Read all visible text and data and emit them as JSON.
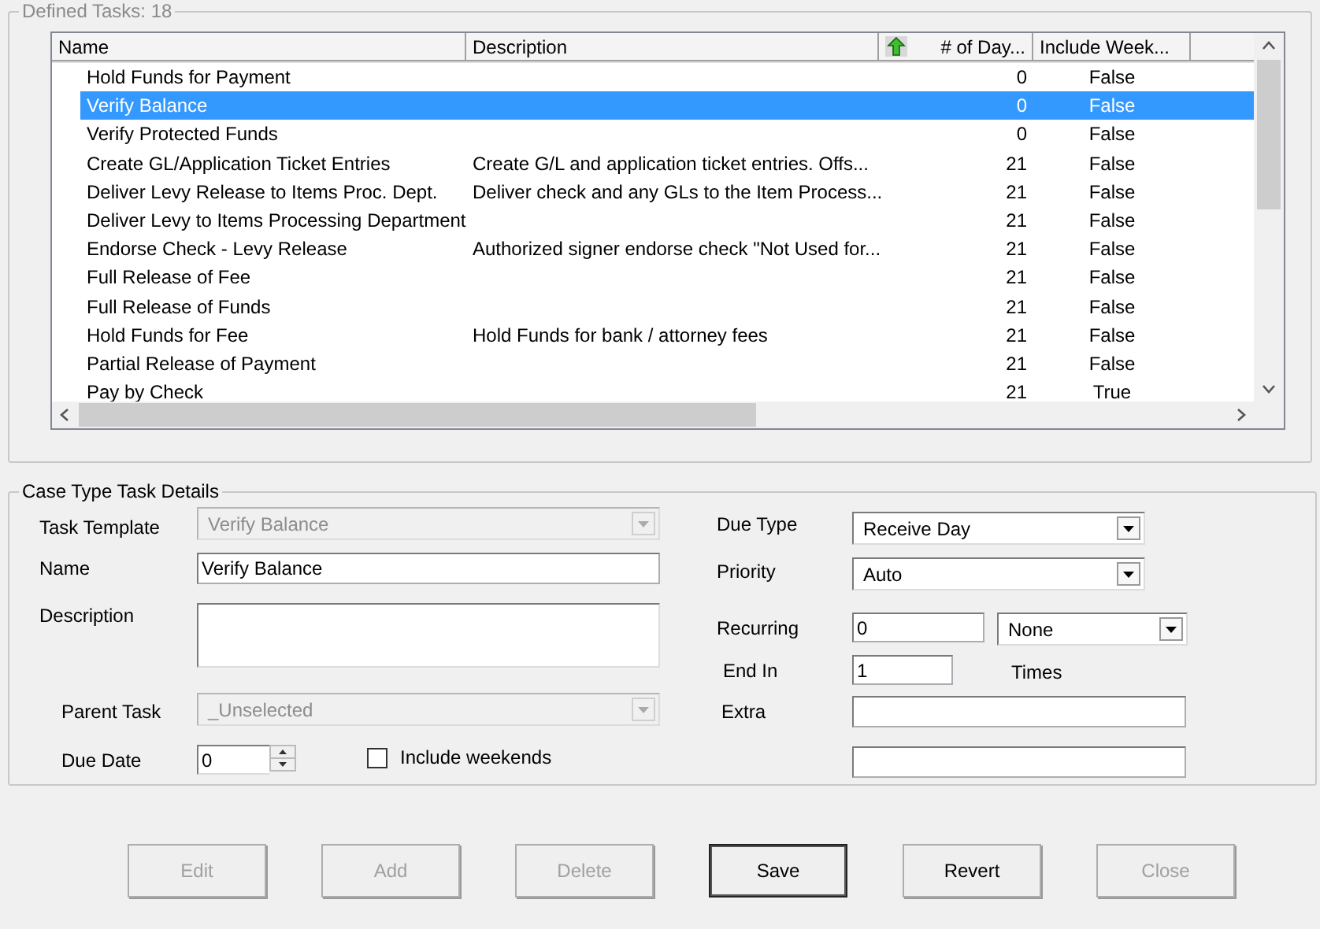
{
  "tasks_group": {
    "title": "Defined Tasks: 18",
    "columns": [
      {
        "label": "Name",
        "sorted": false
      },
      {
        "label": "Description",
        "sorted": false
      },
      {
        "label": "# of Day...",
        "sorted": true
      },
      {
        "label": "Include Week...",
        "sorted": false
      }
    ],
    "rows": [
      {
        "name": "Hold Funds for Payment",
        "description": "",
        "days": "0",
        "include_weekends": "False",
        "selected": false
      },
      {
        "name": "Verify Balance",
        "description": "",
        "days": "0",
        "include_weekends": "False",
        "selected": true
      },
      {
        "name": "Verify Protected Funds",
        "description": "",
        "days": "0",
        "include_weekends": "False",
        "selected": false
      },
      {
        "name": "Create GL/Application Ticket Entries",
        "description": "Create G/L and application ticket entries.  Offs...",
        "days": "21",
        "include_weekends": "False",
        "selected": false
      },
      {
        "name": "Deliver Levy Release to Items Proc. Dept.",
        "description": "Deliver check and any GLs to the Item Process...",
        "days": "21",
        "include_weekends": "False",
        "selected": false
      },
      {
        "name": "Deliver Levy to Items Processing Department",
        "description": "",
        "days": "21",
        "include_weekends": "False",
        "selected": false
      },
      {
        "name": "Endorse Check - Levy Release",
        "description": "Authorized signer endorse check \"Not Used for...",
        "days": "21",
        "include_weekends": "False",
        "selected": false
      },
      {
        "name": "Full Release of Fee",
        "description": "",
        "days": "21",
        "include_weekends": "False",
        "selected": false
      },
      {
        "name": "Full Release of Funds",
        "description": "",
        "days": "21",
        "include_weekends": "False",
        "selected": false
      },
      {
        "name": "Hold Funds for Fee",
        "description": "Hold Funds for bank / attorney fees",
        "days": "21",
        "include_weekends": "False",
        "selected": false
      },
      {
        "name": "Partial Release of Payment",
        "description": "",
        "days": "21",
        "include_weekends": "False",
        "selected": false
      },
      {
        "name": "Pay by Check",
        "description": "",
        "days": "21",
        "include_weekends": "True",
        "selected": false
      }
    ]
  },
  "details_group": {
    "title": "Case Type Task Details",
    "task_template": {
      "label": "Task Template",
      "value": "Verify Balance",
      "disabled": true
    },
    "name": {
      "label": "Name",
      "value": "Verify Balance"
    },
    "description": {
      "label": "Description"
    },
    "parent_task": {
      "label": "Parent Task",
      "value": "_Unselected",
      "disabled": true
    },
    "due_date": {
      "label": "Due Date",
      "value": "0"
    },
    "include_weekends": {
      "label": "Include weekends",
      "checked": false
    },
    "due_type": {
      "label": "Due Type",
      "value": "Receive Day",
      "disabled": false
    },
    "priority": {
      "label": "Priority",
      "value": "Auto",
      "disabled": false
    },
    "recurring": {
      "label": "Recurring",
      "value": "0",
      "unit": "None"
    },
    "end_in": {
      "label": "End In",
      "value": "1",
      "suffix": "Times"
    },
    "extra": {
      "label": "Extra"
    }
  },
  "buttons": [
    {
      "label": "Edit",
      "disabled": true,
      "default": false
    },
    {
      "label": "Add",
      "disabled": true,
      "default": false
    },
    {
      "label": "Delete",
      "disabled": true,
      "default": false
    },
    {
      "label": "Save",
      "disabled": false,
      "default": true
    },
    {
      "label": "Revert",
      "disabled": false,
      "default": false
    },
    {
      "label": "Close",
      "disabled": true,
      "default": false
    }
  ]
}
